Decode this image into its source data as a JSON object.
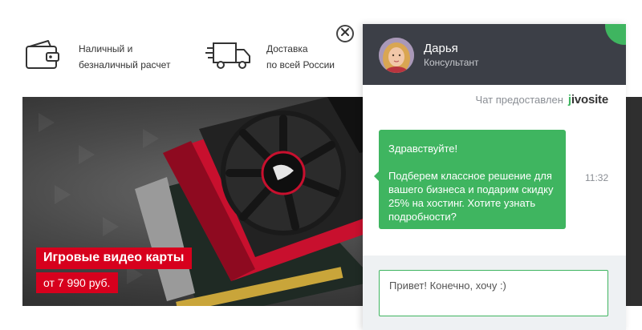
{
  "features": [
    {
      "icon": "wallet-icon",
      "lines": [
        "Наличный и",
        "безналичный расчет"
      ]
    },
    {
      "icon": "truck-icon",
      "lines": [
        "Доставка",
        "по всей России"
      ]
    }
  ],
  "banner": {
    "title": "Игровые видео карты",
    "price": "от 7 990 руб.",
    "accent": "#d7001d"
  },
  "chat": {
    "agent_name": "Дарья",
    "agent_role": "Консультант",
    "provided_by": "Чат предоставлен",
    "brand": "jivosite",
    "message": {
      "greeting": "Здравствуйте!",
      "body": "Подберем классное решение для вашего бизнеса и подарим скидку 25% на хостинг. Хотите узнать подробности?",
      "time": "11:32"
    },
    "input_value": "Привет! Конечно, хочу :)",
    "colors": {
      "header": "#3c3f47",
      "accent": "#3fb560"
    }
  }
}
